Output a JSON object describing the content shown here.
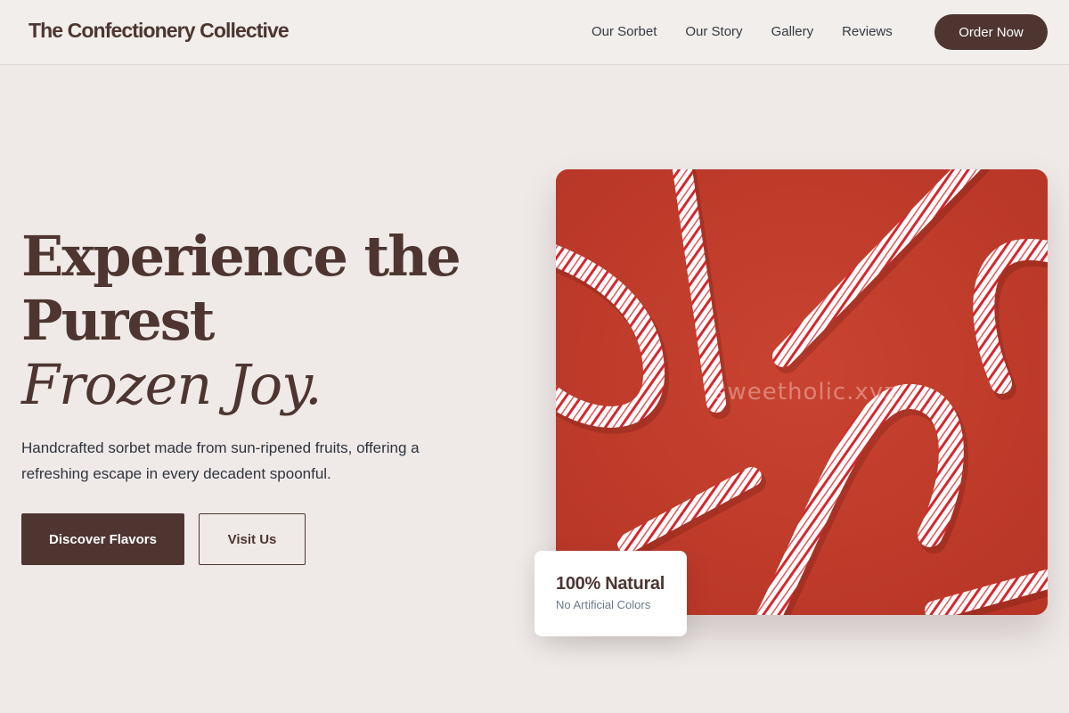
{
  "header": {
    "brand": "The Confectionery Collective",
    "nav_items": [
      "Our Sorbet",
      "Our Story",
      "Gallery",
      "Reviews"
    ],
    "cta_label": "Order Now"
  },
  "hero": {
    "title_line1": "Experience the",
    "title_line2": "Purest",
    "title_accent": "Frozen Joy.",
    "description": "Handcrafted sorbet made from sun-ripened fruits, offering a refreshing escape in every decadent spoonful.",
    "primary_button": "Discover Flavors",
    "secondary_button": "Visit Us",
    "image": {
      "subject": "candy canes on red background",
      "watermark": "sweetholic.xyz"
    }
  },
  "badge": {
    "title": "100% Natural",
    "subtitle": "No Artificial Colors"
  },
  "colors": {
    "brand": "#4e3530",
    "background": "#efeae8",
    "image_bg": "#c13b2b",
    "stripe": "#d8252b"
  }
}
